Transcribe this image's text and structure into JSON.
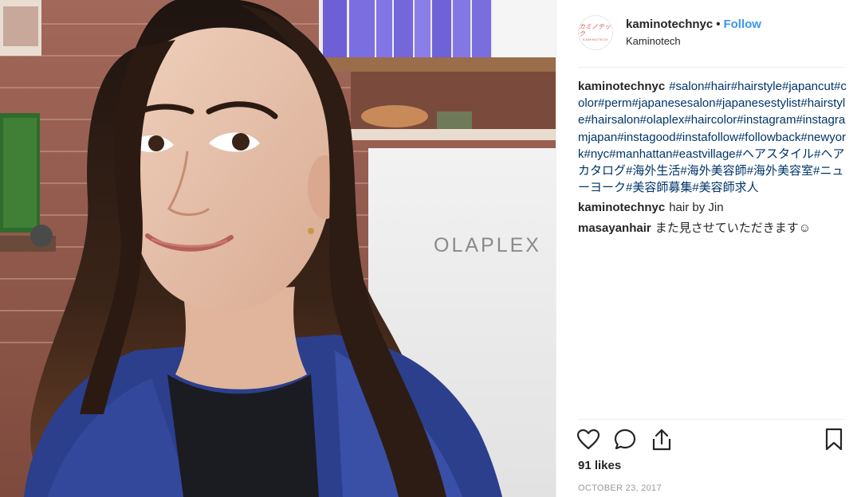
{
  "header": {
    "avatar_logo_top": "カミノテック",
    "avatar_logo_bottom": "KAMINOTECH",
    "username": "kaminotechnyc",
    "separator": "•",
    "follow_label": "Follow",
    "location": "Kaminotech"
  },
  "photo": {
    "sign_text": "OLAPLEX"
  },
  "comments": [
    {
      "user": "kaminotechnyc",
      "text": "#salon#hair#hairstyle#japancut#color#perm#japanesesalon#japanesestylist#hairstyle#hairsalon#olaplex#haircolor#instagram#instagramjapan#instagood#instafollow#followback#newyork#nyc#manhattan#eastvillage#ヘアスタイル#ヘアカタログ#海外生活#海外美容師#海外美容室#ニューヨーク#美容師募集#美容師求人"
    },
    {
      "user": "kaminotechnyc",
      "text": "hair by Jin"
    },
    {
      "user": "masayanhair",
      "text": "また見させていただきます☺"
    }
  ],
  "actions": {
    "like_icon": "heart-icon",
    "comment_icon": "comment-icon",
    "share_icon": "share-icon",
    "save_icon": "bookmark-icon"
  },
  "likes_text": "91 likes",
  "date_text": "OCTOBER 23, 2017",
  "colors": {
    "follow": "#3897f0",
    "hashtag": "#003569",
    "text": "#262626",
    "muted": "#999999"
  }
}
